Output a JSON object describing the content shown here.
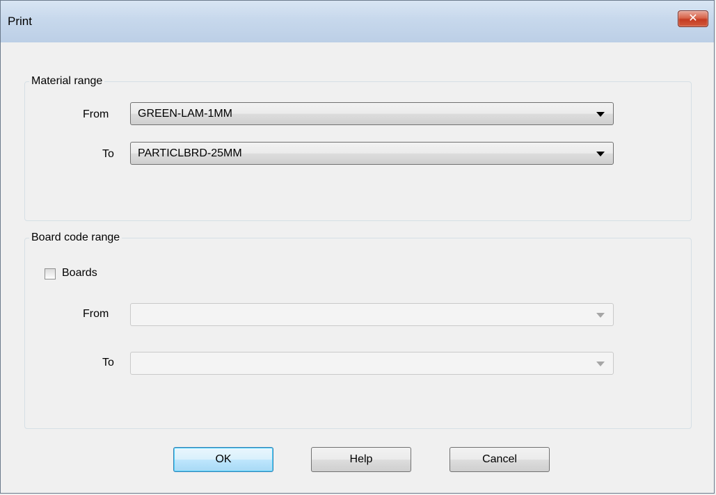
{
  "window": {
    "title": "Print",
    "close_label": "✕"
  },
  "material_range": {
    "legend": "Material range",
    "from_label": "From",
    "from_value": "GREEN-LAM-1MM",
    "to_label": "To",
    "to_value": "PARTICLBRD-25MM"
  },
  "board_code_range": {
    "legend": "Board code range",
    "boards_label": "Boards",
    "boards_checked": false,
    "from_label": "From",
    "from_value": "",
    "to_label": "To",
    "to_value": ""
  },
  "buttons": {
    "ok": "OK",
    "help": "Help",
    "cancel": "Cancel"
  }
}
